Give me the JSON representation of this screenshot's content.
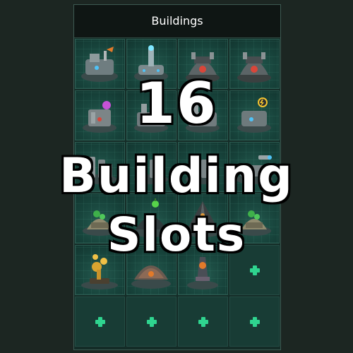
{
  "panel": {
    "title": "Buildings"
  },
  "slots": [
    {
      "kind": "building",
      "icon": "command-center-icon"
    },
    {
      "kind": "building",
      "icon": "research-spire-icon"
    },
    {
      "kind": "building",
      "icon": "reactor-dome-icon"
    },
    {
      "kind": "building",
      "icon": "reactor-dome-icon"
    },
    {
      "kind": "building",
      "icon": "storage-silo-icon"
    },
    {
      "kind": "building",
      "icon": "factory-icon"
    },
    {
      "kind": "building",
      "icon": "factory-icon"
    },
    {
      "kind": "building",
      "icon": "power-plant-icon"
    },
    {
      "kind": "building",
      "icon": "refinery-icon"
    },
    {
      "kind": "building",
      "icon": "refinery-icon"
    },
    {
      "kind": "building",
      "icon": "refinery-icon"
    },
    {
      "kind": "building",
      "icon": "launch-pad-icon"
    },
    {
      "kind": "building",
      "icon": "hydroponics-icon"
    },
    {
      "kind": "building",
      "icon": "biodome-icon"
    },
    {
      "kind": "building",
      "icon": "pyramid-icon"
    },
    {
      "kind": "building",
      "icon": "hydroponics-icon"
    },
    {
      "kind": "building",
      "icon": "golden-monument-icon"
    },
    {
      "kind": "building",
      "icon": "habitat-dome-icon"
    },
    {
      "kind": "building",
      "icon": "tower-icon"
    },
    {
      "kind": "empty",
      "icon": "plus-icon"
    },
    {
      "kind": "empty",
      "icon": "plus-icon"
    },
    {
      "kind": "empty",
      "icon": "plus-icon"
    },
    {
      "kind": "empty",
      "icon": "plus-icon"
    },
    {
      "kind": "empty",
      "icon": "plus-icon"
    }
  ],
  "overlay": {
    "line1": "16",
    "line2": "Building",
    "line3": "Slots"
  },
  "colors": {
    "background": "#1c2622",
    "slot": "#17433b",
    "add": "#2fd48f"
  }
}
